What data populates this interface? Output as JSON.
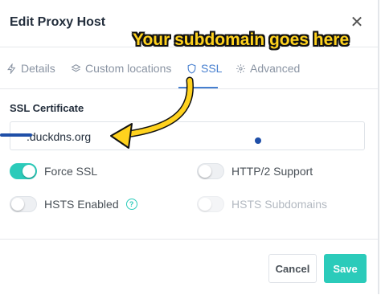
{
  "modal": {
    "title": "Edit Proxy Host",
    "close_icon": "close-icon"
  },
  "tabs": [
    {
      "label": "Details",
      "icon": "bolt-icon",
      "active": false
    },
    {
      "label": "Custom locations",
      "icon": "layers-icon",
      "active": false
    },
    {
      "label": "SSL",
      "icon": "shield-icon",
      "active": true
    },
    {
      "label": "Advanced",
      "icon": "gear-icon",
      "active": false
    }
  ],
  "ssl": {
    "section_label": "SSL Certificate",
    "certificate_value": ".duckdns.org",
    "options": [
      {
        "label": "Force SSL",
        "on": true,
        "disabled": false
      },
      {
        "label": "HTTP/2 Support",
        "on": false,
        "disabled": false
      },
      {
        "label": "HSTS Enabled",
        "on": false,
        "disabled": false,
        "help_icon": "question-circle-icon",
        "help_glyph": "?"
      },
      {
        "label": "HSTS Subdomains",
        "on": false,
        "disabled": true
      }
    ]
  },
  "footer": {
    "cancel_label": "Cancel",
    "save_label": "Save"
  },
  "annotation": {
    "text": "Your subdomain goes here"
  },
  "colors": {
    "accent": "#2bcbba",
    "tab_active": "#467fcf",
    "annotation_fill": "#ffd21e"
  }
}
